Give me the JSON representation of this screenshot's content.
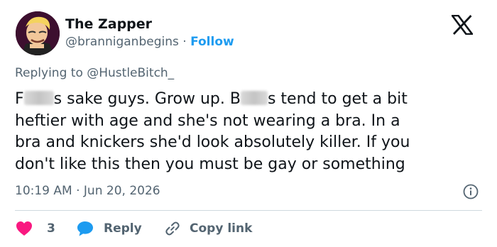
{
  "author": {
    "name": "The Zapper",
    "handle": "@branniganbegins",
    "separator": "·",
    "follow_label": "Follow"
  },
  "reply_context": {
    "prefix": "Replying to ",
    "mention": "@HustleBitch_"
  },
  "tweet": {
    "line1_a": "F",
    "line1_b": "s sake guys. Grow up. B",
    "line1_c": "s tend to get a bit",
    "line2": "heftier with age and she's not wearing a bra. In a",
    "line3": "bra and knickers she'd look absolutely killer. If you",
    "line4": "don't like this then you must be gay or something"
  },
  "timestamp": {
    "time": "10:19 AM",
    "separator": "·",
    "date": "Jun 20, 2026"
  },
  "actions": {
    "like_count": "3",
    "reply_label": "Reply",
    "copy_label": "Copy link"
  },
  "colors": {
    "like": "#f91880",
    "reply": "#1d9bf0",
    "link": "#1d9bf0",
    "secondary_text": "#536471"
  },
  "icons": {
    "logo": "x-logo-icon",
    "info": "info-icon",
    "like": "heart-icon",
    "reply": "speech-bubble-icon",
    "copy": "link-icon"
  }
}
